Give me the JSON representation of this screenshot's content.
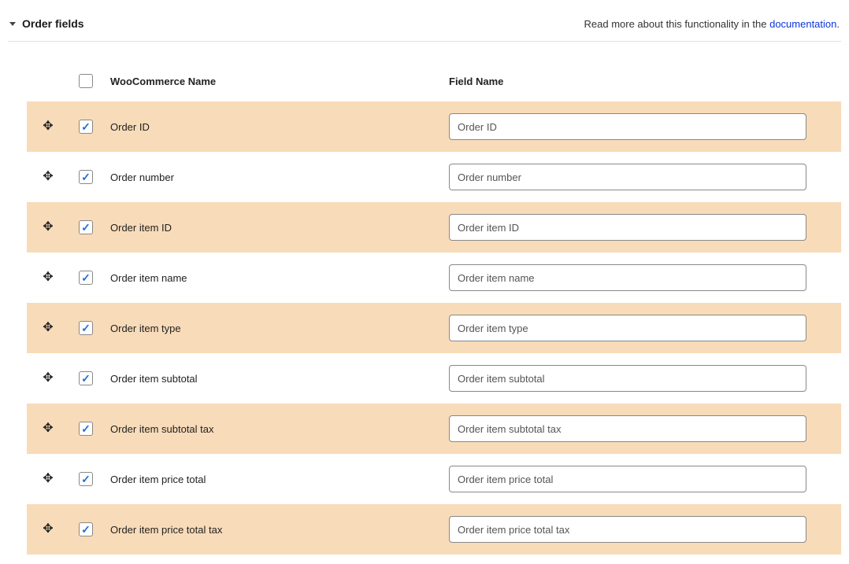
{
  "section": {
    "title": "Order fields",
    "note_prefix": "Read more about this functionality in the ",
    "note_link_text": "documentation",
    "note_suffix": ".",
    "wc_name_header": "WooCommerce Name",
    "field_name_header": "Field Name",
    "select_all_checked": false
  },
  "rows": [
    {
      "checked": true,
      "wc_name": "Order ID",
      "field_name": "Order ID"
    },
    {
      "checked": true,
      "wc_name": "Order number",
      "field_name": "Order number"
    },
    {
      "checked": true,
      "wc_name": "Order item ID",
      "field_name": "Order item ID"
    },
    {
      "checked": true,
      "wc_name": "Order item name",
      "field_name": "Order item name"
    },
    {
      "checked": true,
      "wc_name": "Order item type",
      "field_name": "Order item type"
    },
    {
      "checked": true,
      "wc_name": "Order item subtotal",
      "field_name": "Order item subtotal"
    },
    {
      "checked": true,
      "wc_name": "Order item subtotal tax",
      "field_name": "Order item subtotal tax"
    },
    {
      "checked": true,
      "wc_name": "Order item price total",
      "field_name": "Order item price total"
    },
    {
      "checked": true,
      "wc_name": "Order item price total tax",
      "field_name": "Order item price total tax"
    }
  ]
}
